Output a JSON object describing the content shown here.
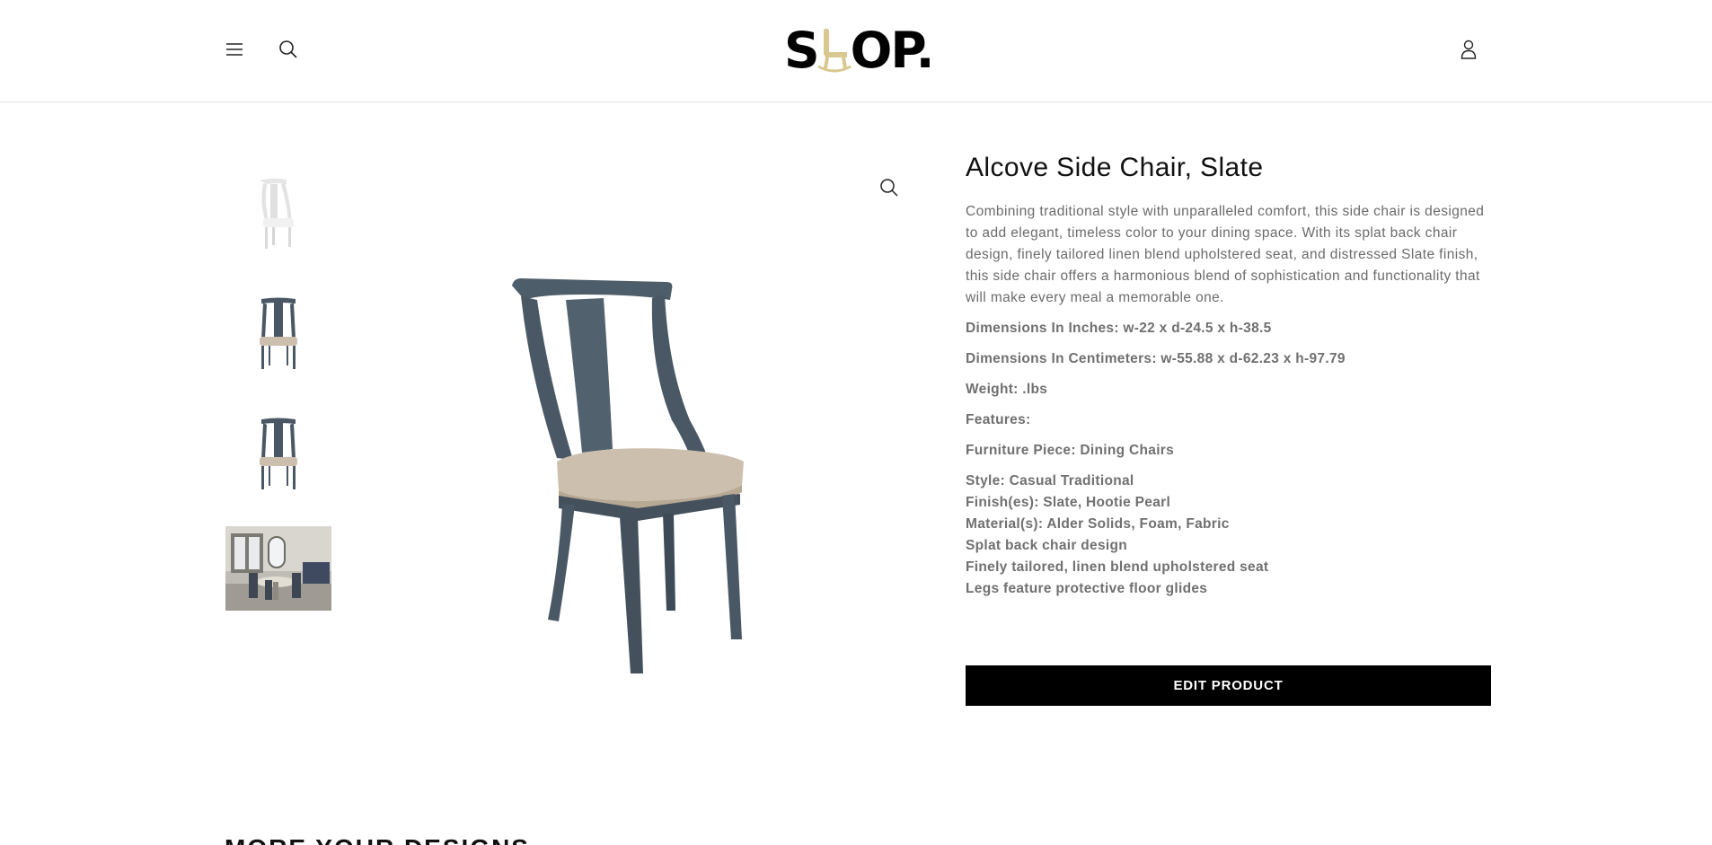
{
  "header": {
    "logo": {
      "text_before": "S",
      "text_after": "OP."
    },
    "icons": {
      "menu": "menu-icon",
      "search": "search-icon",
      "account": "account-icon"
    }
  },
  "gallery": {
    "thumbnails": [
      {
        "name": "chair-white-thumbnail"
      },
      {
        "name": "chair-slate-front-thumbnail"
      },
      {
        "name": "chair-slate-front-2-thumbnail"
      },
      {
        "name": "dining-room-scene-thumbnail"
      }
    ],
    "zoom_icon": "zoom-icon"
  },
  "product": {
    "title": "Alcove Side Chair, Slate",
    "description": "Combining traditional style with unparalleled comfort, this side chair is designed to add elegant, timeless color to your dining space. With its splat back chair design, finely tailored linen blend upholstered seat, and distressed Slate finish, this side chair offers a harmonious blend of sophistication and functionality that will make every meal a memorable one.",
    "dimensions_inches": "Dimensions In Inches: w-22 x d-24.5 x h-38.5",
    "dimensions_cm": "Dimensions In Centimeters: w-55.88 x d-62.23 x h-97.79",
    "weight": "Weight: .lbs",
    "features": "Features:",
    "furniture_piece": "Furniture Piece: Dining Chairs",
    "details": [
      "Style: Casual Traditional",
      "Finish(es): Slate, Hootie Pearl",
      "Material(s): Alder Solids, Foam, Fabric",
      "Splat back chair design",
      "Finely tailored, linen blend upholstered seat",
      "Legs feature protective floor glides"
    ],
    "edit_button": "EDIT PRODUCT"
  },
  "section_heading": "MORE YOUR DESIGNS",
  "colors": {
    "slate": "#4a5865",
    "seat": "#cdbfae",
    "logo_accent": "#d8c88f",
    "button": "#000000"
  }
}
